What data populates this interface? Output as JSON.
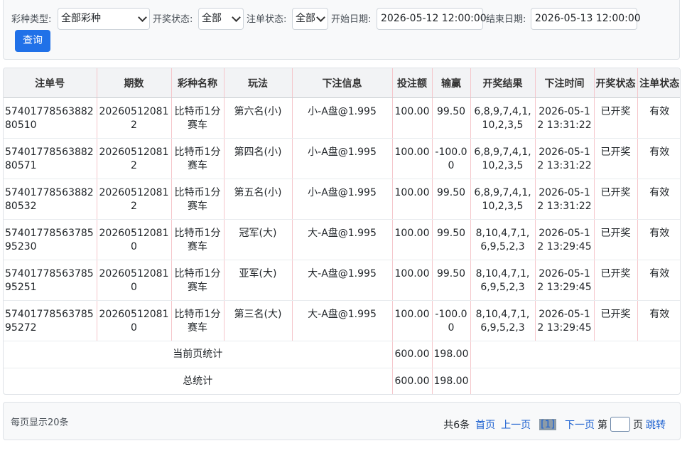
{
  "filters": {
    "lottery_type_label": "彩种类型:",
    "lottery_type_value": "全部彩种",
    "draw_status_label": "开奖状态:",
    "draw_status_value": "全部",
    "bet_status_label": "注单状态:",
    "bet_status_value": "全部",
    "start_date_label": "开始日期:",
    "start_date_value": "2026-05-12 12:00:00",
    "end_date_label": "结束日期:",
    "end_date_value": "2026-05-13 12:00:00",
    "query_button": "查询"
  },
  "table": {
    "headers": [
      "注单号",
      "期数",
      "彩种名称",
      "玩法",
      "下注信息",
      "投注额",
      "输赢",
      "开奖结果",
      "下注时间",
      "开奖状态",
      "注单状态"
    ],
    "rows": [
      [
        "5740177856388280510",
        "202605120812",
        "比特币1分赛车",
        "第六名(小)",
        "小-A盘@1.995",
        "100.00",
        "99.50",
        "6,8,9,7,4,1,10,2,3,5",
        "2026-05-12 13:31:22",
        "已开奖",
        "有效"
      ],
      [
        "5740177856388280571",
        "202605120812",
        "比特币1分赛车",
        "第四名(小)",
        "小-A盘@1.995",
        "100.00",
        "-100.00",
        "6,8,9,7,4,1,10,2,3,5",
        "2026-05-12 13:31:22",
        "已开奖",
        "有效"
      ],
      [
        "5740177856388280532",
        "202605120812",
        "比特币1分赛车",
        "第五名(小)",
        "小-A盘@1.995",
        "100.00",
        "99.50",
        "6,8,9,7,4,1,10,2,3,5",
        "2026-05-12 13:31:22",
        "已开奖",
        "有效"
      ],
      [
        "5740177856378595230",
        "202605120810",
        "比特币1分赛车",
        "冠军(大)",
        "大-A盘@1.995",
        "100.00",
        "99.50",
        "8,10,4,7,1,6,9,5,2,3",
        "2026-05-12 13:29:45",
        "已开奖",
        "有效"
      ],
      [
        "5740177856378595251",
        "202605120810",
        "比特币1分赛车",
        "亚军(大)",
        "大-A盘@1.995",
        "100.00",
        "99.50",
        "8,10,4,7,1,6,9,5,2,3",
        "2026-05-12 13:29:45",
        "已开奖",
        "有效"
      ],
      [
        "5740177856378595272",
        "202605120810",
        "比特币1分赛车",
        "第三名(大)",
        "大-A盘@1.995",
        "100.00",
        "-100.00",
        "8,10,4,7,1,6,9,5,2,3",
        "2026-05-12 13:29:45",
        "已开奖",
        "有效"
      ]
    ],
    "page_summary": {
      "label": "当前页统计",
      "bet_total": "600.00",
      "win_total": "198.00"
    },
    "grand_summary": {
      "label": "总统计",
      "bet_total": "600.00",
      "win_total": "198.00"
    }
  },
  "pager": {
    "per_page": "每页显示20条",
    "total": "共6条",
    "first": "首页",
    "prev": "上一页",
    "current": "[1]",
    "next": "下一页",
    "goto_prefix": "第",
    "goto_suffix": "页",
    "jump": "跳转"
  }
}
